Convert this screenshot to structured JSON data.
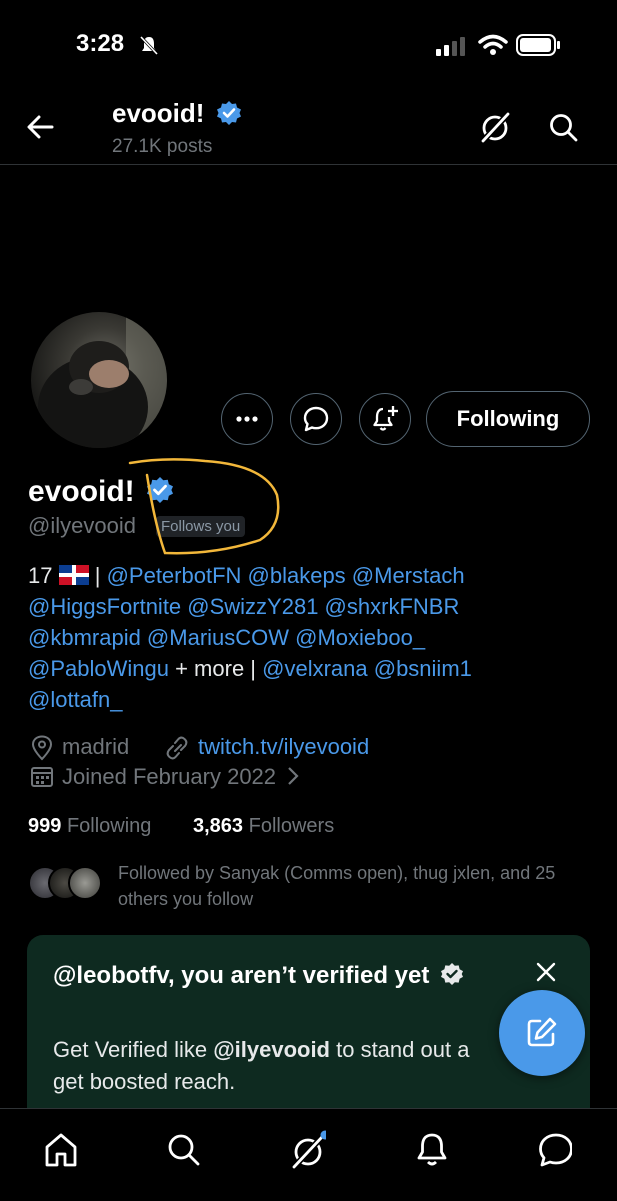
{
  "status_bar": {
    "time": "3:28"
  },
  "header": {
    "title": "evooid!",
    "posts": "27.1K posts"
  },
  "profile": {
    "display_name": "evooid!",
    "handle": "@ilyevooid",
    "follows_you": "Follows you",
    "buttons": {
      "more": "more",
      "message": "message",
      "notify": "notify",
      "following": "Following"
    },
    "bio": {
      "line1_prefix": "17",
      "line1_sep": "|",
      "line1_links": "@PeterbotFN @blakeps @Merstach",
      "line2": "@HiggsFortnite @SwizzY281 @shxrkFNBR",
      "line3": "@kbmrapid @MariusCOW @Moxieboo_",
      "line4_link": "@PabloWingu",
      "line4_text": "+ more |",
      "line4_links2": "@velxrana @bsniim1",
      "line5": "@lottafn_"
    },
    "location": "madrid",
    "website": "twitch.tv/ilyevooid",
    "joined": "Joined February 2022",
    "following_count": "999",
    "following_label": "Following",
    "followers_count": "3,863",
    "followers_label": "Followers",
    "followed_by": "Followed by Sanyak (Comms open), thug jxlen, and 25 others you follow"
  },
  "verify_card": {
    "title": "@leobotfv, you aren’t verified yet",
    "body_prefix": "Get Verified like ",
    "body_handle": "@ilyevooid",
    "body_suffix": " to stand out a get boosted reach."
  },
  "colors": {
    "accent": "#4a99e9",
    "annotation": "#f2b73a",
    "card": "#0e2a20"
  },
  "icons": [
    "back-arrow-icon",
    "grok-icon",
    "search-icon",
    "verified-badge-icon",
    "more-icon",
    "message-icon",
    "notify-bell-icon",
    "location-icon",
    "link-icon",
    "calendar-icon",
    "close-icon",
    "compose-icon",
    "home-icon",
    "explore-icon",
    "notifications-icon",
    "messages-icon"
  ]
}
